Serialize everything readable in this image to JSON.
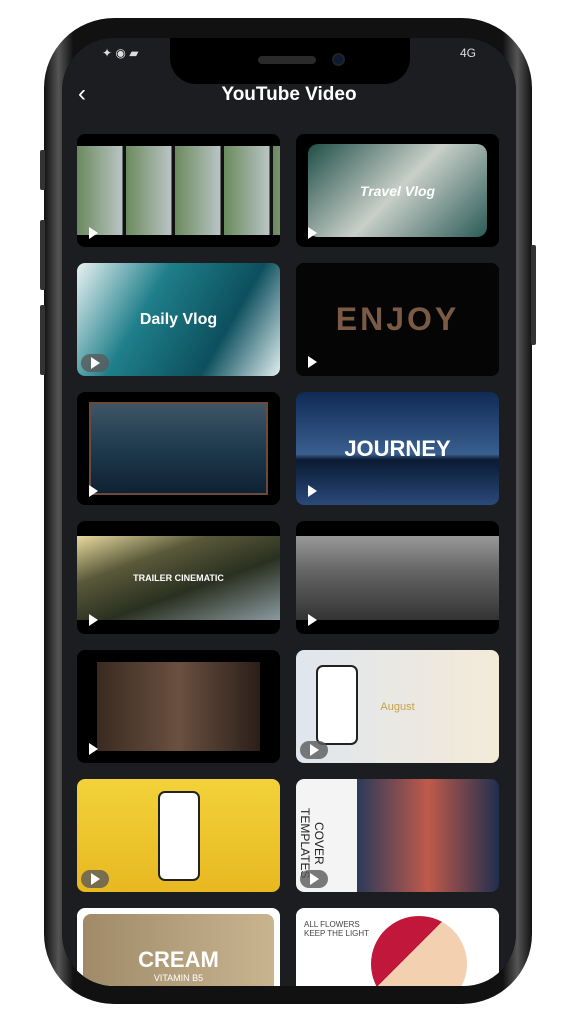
{
  "status_bar": {
    "network": "4G"
  },
  "header": {
    "back_icon": "chevron-left-icon",
    "title": "YouTube Video"
  },
  "templates": [
    {
      "caption": ""
    },
    {
      "caption": "Travel Vlog"
    },
    {
      "caption": "Daily Vlog"
    },
    {
      "caption": "ENJOY"
    },
    {
      "caption": ""
    },
    {
      "caption": "JOURNEY"
    },
    {
      "caption": "TRAILER CINEMATIC"
    },
    {
      "caption": ""
    },
    {
      "caption": ""
    },
    {
      "caption": "August"
    },
    {
      "caption": ""
    },
    {
      "caption": "COVER TEMPLATES"
    },
    {
      "caption": "CREAM",
      "subcaption": "VITAMIN B5"
    },
    {
      "caption": "ALL FLOWERS KEEP THE LIGHT"
    }
  ]
}
